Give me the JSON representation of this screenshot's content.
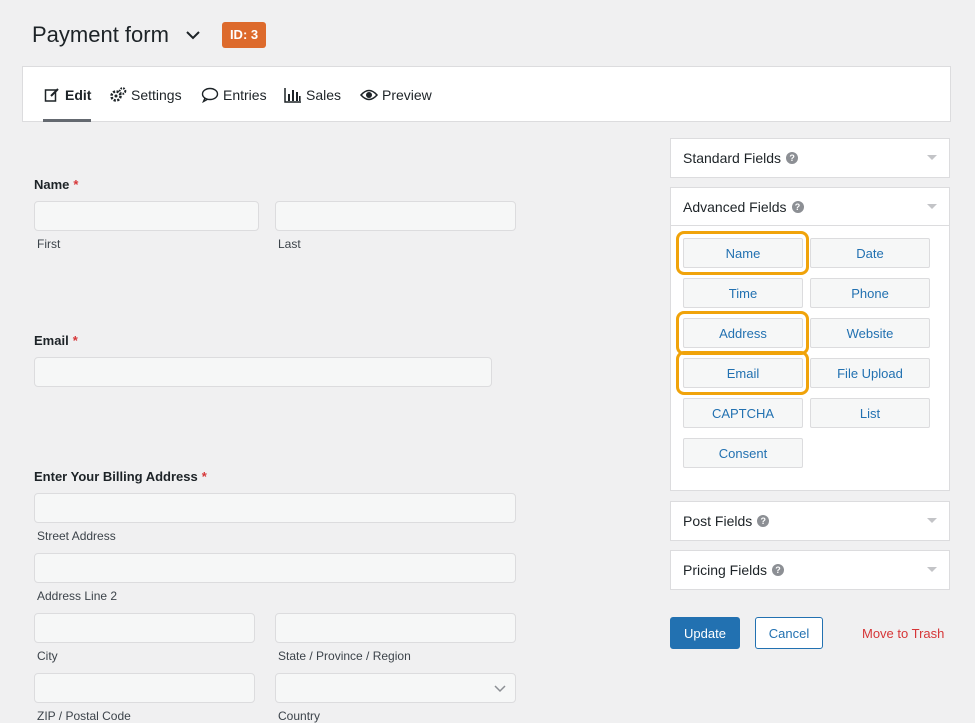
{
  "header": {
    "title": "Payment form",
    "id_badge": "ID: 3"
  },
  "tabs": [
    {
      "label": "Edit",
      "icon": "edit-icon",
      "active": true
    },
    {
      "label": "Settings",
      "icon": "gear-icon",
      "active": false
    },
    {
      "label": "Entries",
      "icon": "comment-icon",
      "active": false
    },
    {
      "label": "Sales",
      "icon": "bar-chart-icon",
      "active": false
    },
    {
      "label": "Preview",
      "icon": "eye-icon",
      "active": false
    }
  ],
  "form": {
    "name": {
      "label": "Name",
      "required": "*",
      "first": "First",
      "last": "Last"
    },
    "email": {
      "label": "Email",
      "required": "*"
    },
    "address": {
      "label": "Enter Your Billing Address",
      "required": "*",
      "street": "Street Address",
      "line2": "Address Line 2",
      "city": "City",
      "state": "State / Province / Region",
      "zip": "ZIP / Postal Code",
      "country": "Country"
    }
  },
  "sidebar": {
    "standard": "Standard Fields",
    "advanced": "Advanced Fields",
    "advanced_buttons": [
      "Name",
      "Date",
      "Time",
      "Phone",
      "Address",
      "Website",
      "Email",
      "File Upload",
      "CAPTCHA",
      "List",
      "Consent"
    ],
    "highlighted": [
      "Name",
      "Address",
      "Email"
    ],
    "post": "Post Fields",
    "pricing": "Pricing Fields",
    "help_mark": "?"
  },
  "actions": {
    "update": "Update",
    "cancel": "Cancel",
    "trash": "Move to Trash"
  },
  "colors": {
    "accent": "#2271b1",
    "badge": "#dd6a2c",
    "highlight": "#f0a30a",
    "danger": "#d63638"
  }
}
